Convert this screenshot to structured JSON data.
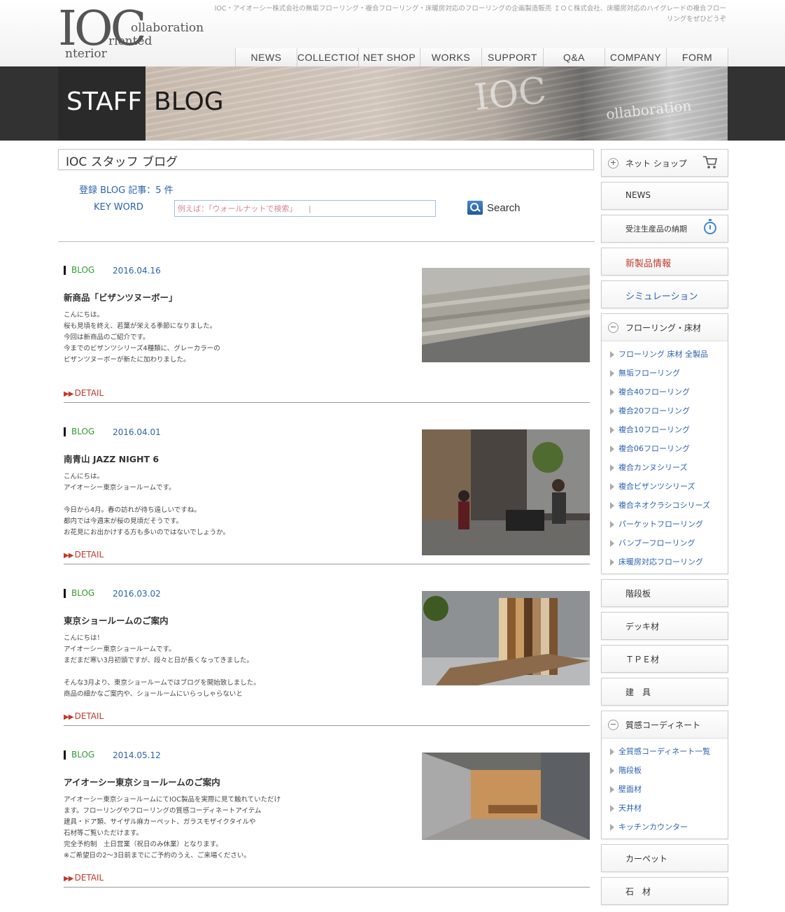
{
  "site": {
    "logo": {
      "big": "IOC",
      "line1": "ollaboration",
      "line2": "riented",
      "line3": "nterior"
    },
    "tagline": "IOC・アイオーシー株式会社の無垢フローリング・複合フローリング・床暖房対応のフローリングの企画製造販売 ＩＯＣ株式会社、床暖房対応のハイグレードの複合フローリングをぜひどうぞ"
  },
  "nav": {
    "items": [
      "NEWS",
      "COLLECTION",
      "NET SHOP",
      "WORKS",
      "SUPPORT",
      "Q&A",
      "COMPANY",
      "FORM"
    ]
  },
  "hero": {
    "staff": "STAFF",
    "blog": "BLOG",
    "sign": "IOC",
    "sign_sub": "ollaboration"
  },
  "main": {
    "title": "IOC スタッフ ブログ",
    "count": "登録 BLOG 記事：5 件",
    "keyword_label": "KEY WORD",
    "search_placeholder": "例えば：「ウォールナットで検索」　　|",
    "search_button": "Search"
  },
  "posts": [
    {
      "category": "BLOG",
      "date": "2016.04.16",
      "title": "新商品「ビザンツヌーボー」",
      "excerpt": "こんにちは。\n桜も見頃を終え、若葉が栄える季節になりました。\n今回は新商品のご紹介です。\n今までのビザンツシリーズ4種類に、グレーカラーの\nビザンツヌーボーが新たに加わりました。",
      "detail": "DETAIL",
      "image": "grey-wood-flooring-photo"
    },
    {
      "category": "BLOG",
      "date": "2016.04.01",
      "title": "南青山 JAZZ NIGHT 6",
      "excerpt": "こんにちは。\nアイオーシー東京ショールームです。\n\n今日から4月。春の訪れが待ち遠しいですね。\n都内では今週末が桜の見頃だそうです。\nお花見にお出かけする方も多いのではないでしょうか。",
      "detail": "DETAIL",
      "image": "jazz-night-photo"
    },
    {
      "category": "BLOG",
      "date": "2016.03.02",
      "title": "東京ショールームのご案内",
      "excerpt": "こんにちは！\nアイオーシー東京ショールームです。\nまだまだ寒い3月初頭ですが、段々と日が長くなってきました。\n\nそんな3月より、東京ショールームではブログを開始致しました。\n商品の細かなご案内や、ショールームにいらっしゃらないと",
      "detail": "DETAIL",
      "image": "showroom-samples-photo"
    },
    {
      "category": "BLOG",
      "date": "2014.05.12",
      "title": "アイオーシー東京ショールームのご案内",
      "excerpt": "アイオーシー東京ショールームにてIOC製品を実際に見て触れていただけ\nます。フローリングやフローリングの質感コーディネートアイテム\n建具・ドア類、サイザル麻カーペット、ガラスモザイクタイルや\n石材等ご覧いただけます。\n完全予約制　土日営業（祝日のみ休業）となります。\n※ご希望日の2～3日前までにご予約のうえ、ご来場ください。",
      "detail": "DETAIL",
      "image": "showroom-interior-photo"
    }
  ],
  "sidebar": {
    "netshop": "ネット ショップ",
    "news": "NEWS",
    "delivery": "受注生産品の納期",
    "new_products": "新製品情報",
    "new_products_color": "#c0392b",
    "simulation": "シミュレーション",
    "flooring_head": "フローリング・床材",
    "flooring_items": [
      "フローリング 床材 全製品",
      "無垢フローリング",
      "複合40フローリング",
      "複合20フローリング",
      "複合10フローリング",
      "複合06フローリング",
      "複合カンヌシリーズ",
      "複合ビザンツシリーズ",
      "複合ネオクラシコシリーズ",
      "パーケットフローリング",
      "バンブーフローリング",
      "床暖房対応フローリング"
    ],
    "stairs": "階段板",
    "deck": "デッキ材",
    "tpe": "ＴＰＥ材",
    "fittings": "建　具",
    "texture_head": "質感コーディネート",
    "texture_items": [
      "全質感コーディネート一覧",
      "階段板",
      "壁面材",
      "天井材",
      "キッチンカウンター"
    ],
    "carpet": "カーペット",
    "stone": "石　材"
  }
}
